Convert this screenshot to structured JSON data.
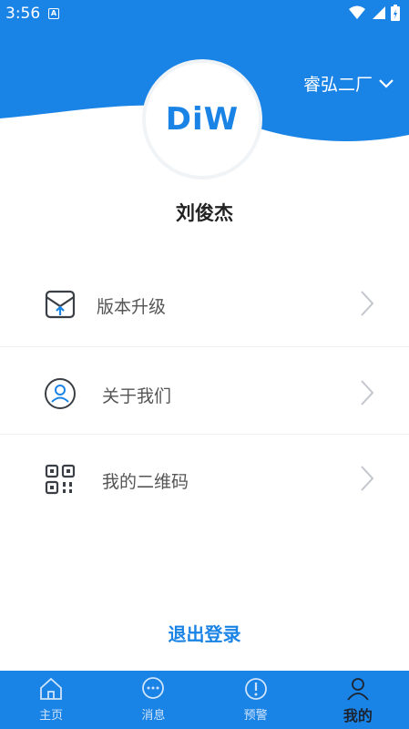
{
  "status_bar": {
    "time": "3:56",
    "notification_glyph": "A"
  },
  "header": {
    "org_name": "睿弘二厂",
    "logo_text": "DiW",
    "user_name": "刘俊杰"
  },
  "menu": {
    "items": [
      {
        "label": "版本升级",
        "icon": "upgrade-box-icon"
      },
      {
        "label": "关于我们",
        "icon": "user-circle-icon"
      },
      {
        "label": "我的二维码",
        "icon": "qr-code-icon"
      }
    ]
  },
  "logout_label": "退出登录",
  "tabbar": {
    "tabs": [
      {
        "label": "主页",
        "icon": "home-icon",
        "active": false
      },
      {
        "label": "消息",
        "icon": "chat-bubble-icon",
        "active": false
      },
      {
        "label": "预警",
        "icon": "alert-icon",
        "active": false
      },
      {
        "label": "我的",
        "icon": "user-icon",
        "active": true
      }
    ]
  },
  "colors": {
    "primary": "#1a83e6",
    "text_dark": "#222222",
    "text_muted": "#555555"
  }
}
